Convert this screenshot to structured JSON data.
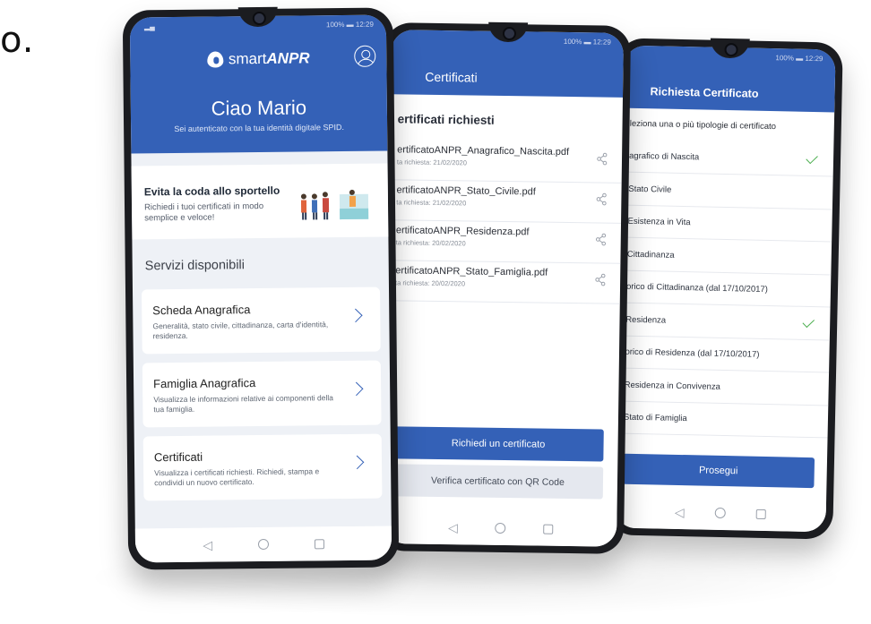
{
  "fragment_text": "o.",
  "status_bar": {
    "time": "12:29",
    "battery": "100%"
  },
  "phone1": {
    "logo_prefix": "smart",
    "logo_suffix": "ANPR",
    "greeting": "Ciao Mario",
    "greeting_sub": "Sei autenticato con la tua identità digitale SPID.",
    "promo": {
      "title": "Evita la coda allo sportello",
      "text": "Richiedi i tuoi certificati in modo semplice e veloce!"
    },
    "section_title": "Servizi disponibili",
    "cards": [
      {
        "title": "Scheda Anagrafica",
        "desc": "Generalità, stato civile, cittadinanza, carta d'identità, residenza."
      },
      {
        "title": "Famiglia Anagrafica",
        "desc": "Visualizza le informazioni relative ai componenti della tua famiglia."
      },
      {
        "title": "Certificati",
        "desc": "Visualizza i certificati richiesti. Richiedi, stampa e condividi un nuovo certificato."
      }
    ]
  },
  "phone2": {
    "title": "Certificati",
    "list_head": "ertificati richiesti",
    "certificates": [
      {
        "name": "ertificatoANPR_Anagrafico_Nascita.pdf",
        "date": "ta richiesta: 21/02/2020"
      },
      {
        "name": "ertificatoANPR_Stato_Civile.pdf",
        "date": "ta richiesta: 21/02/2020"
      },
      {
        "name": "ertificatoANPR_Residenza.pdf",
        "date": "ta richiesta: 20/02/2020"
      },
      {
        "name": "ertificatoANPR_Stato_Famiglia.pdf",
        "date": "ta richiesta: 20/02/2020"
      }
    ],
    "primary_button": "Richiedi un certificato",
    "secondary_button": "Verifica certificato con QR Code"
  },
  "phone3": {
    "title": "Richiesta Certificato",
    "instruction": "leziona una o più tipologie di certificato",
    "options": [
      {
        "label": "agrafico di Nascita",
        "checked": true
      },
      {
        "label": "Stato Civile",
        "checked": false
      },
      {
        "label": "Esistenza in Vita",
        "checked": false
      },
      {
        "label": "Cittadinanza",
        "checked": false
      },
      {
        "label": "orico di Cittadinanza (dal 17/10/2017)",
        "checked": false
      },
      {
        "label": "Residenza",
        "checked": true
      },
      {
        "label": "orico di Residenza (dal 17/10/2017)",
        "checked": false
      },
      {
        "label": "Residenza in Convivenza",
        "checked": false
      },
      {
        "label": "Stato di Famiglia",
        "checked": false
      }
    ],
    "primary_button": "Prosegui"
  }
}
